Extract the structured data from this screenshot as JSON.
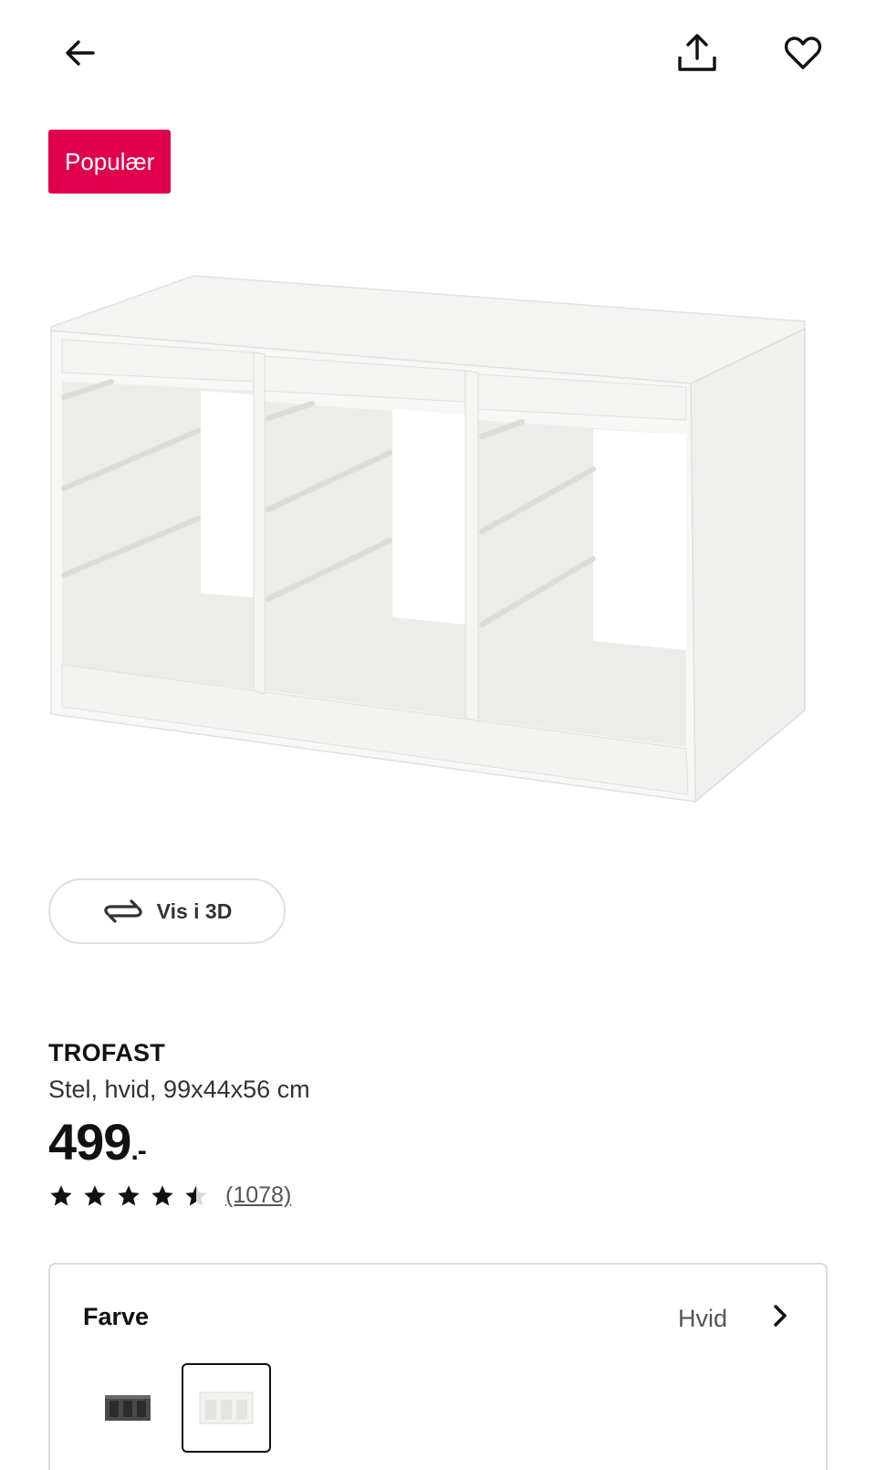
{
  "header": {
    "back_icon": "arrow-left-icon",
    "share_icon": "share-icon",
    "favorite_icon": "heart-icon"
  },
  "badge": {
    "label": "Populær",
    "color": "#e0004d"
  },
  "view3d": {
    "label": "Vis i 3D",
    "icon": "rotate-icon"
  },
  "product": {
    "name": "TROFAST",
    "description": "Stel, hvid, 99x44x56 cm",
    "price": "499",
    "price_suffix": ".-",
    "rating": 4.5,
    "review_count": "(1078)"
  },
  "color_selector": {
    "title": "Farve",
    "selected_value": "Hvid",
    "options": [
      "gray",
      "white"
    ]
  }
}
